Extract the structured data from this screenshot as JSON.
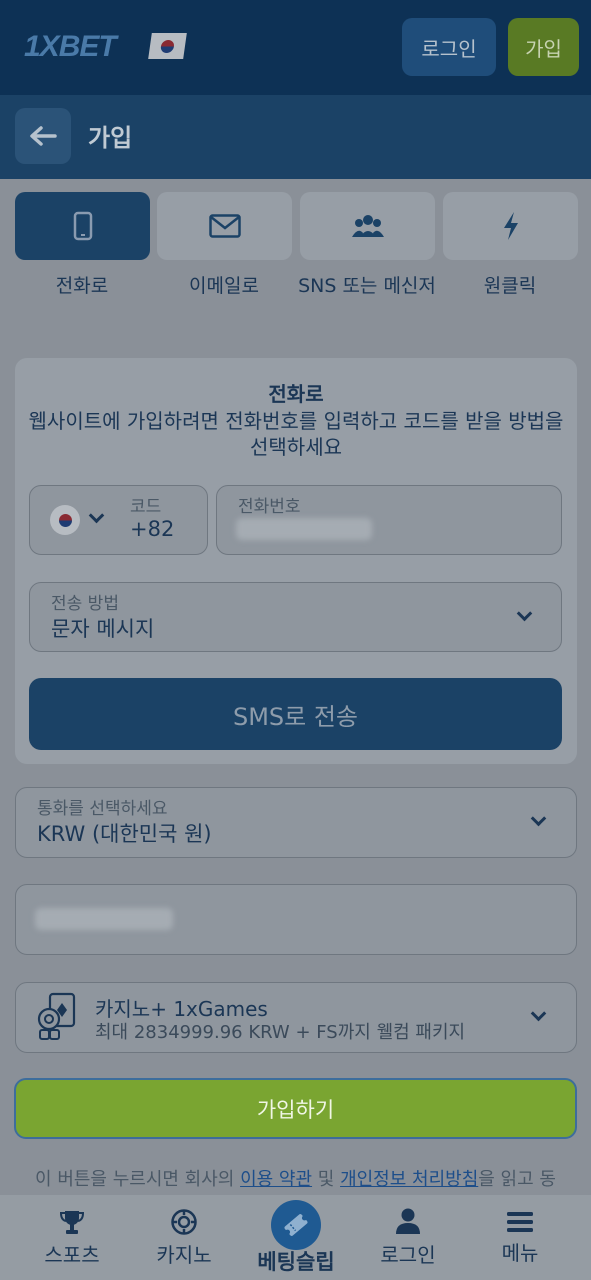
{
  "header": {
    "logo": "1XBET",
    "login_label": "로그인",
    "join_label": "가입"
  },
  "titlebar": {
    "title": "가입"
  },
  "tabs": [
    {
      "label": "전화로",
      "icon": "phone-icon",
      "active": true
    },
    {
      "label": "이메일로",
      "icon": "envelope-icon",
      "active": false
    },
    {
      "label": "SNS 또는 메신저",
      "icon": "people-icon",
      "active": false
    },
    {
      "label": "원클릭",
      "icon": "lightning-icon",
      "active": false
    }
  ],
  "phone_card": {
    "title": "전화로",
    "description": "웹사이트에 가입하려면 전화번호를 입력하고 코드를 받을 방법을 선택하세요",
    "code_label": "코드",
    "code_value": "+82",
    "phone_label": "전화번호",
    "send_method_label": "전송 방법",
    "send_method_value": "문자 메시지",
    "send_button": "SMS로 전송"
  },
  "currency": {
    "label": "통화를 선택하세요",
    "value": "KRW (대한민국 원)"
  },
  "bonus": {
    "title": "카지노+ 1xGames",
    "subtitle": "최대 2834999.96 KRW + FS까지 웰컴 패키지"
  },
  "join_button": "가입하기",
  "terms": {
    "prefix": "이 버튼을 누르시면 회사의 ",
    "link1": "이용 약관",
    "middle": " 및 ",
    "link2": "개인정보 처리방침",
    "suffix": "을 읽고 동"
  },
  "bottom_nav": {
    "sports": "스포츠",
    "casino": "카지노",
    "betslip": "베팅슬립",
    "login": "로그인",
    "menu": "메뉴"
  },
  "colors": {
    "header_bg": "#0d3155",
    "accent_blue": "#1b4266",
    "join_green": "#7aa531",
    "overlay_bg": "#8a9098"
  }
}
